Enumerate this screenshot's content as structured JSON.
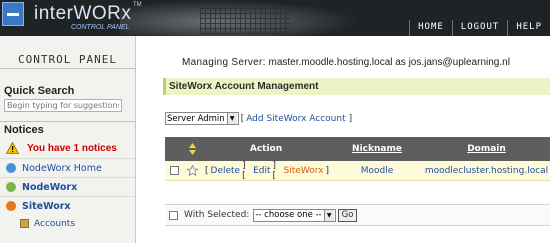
{
  "header": {
    "logo_text": "interWORx",
    "logo_tm": "TM",
    "logo_subtitle": "CONTROL PANEL",
    "nav": [
      "HOME",
      "LOGOUT",
      "HELP"
    ]
  },
  "sidebar": {
    "title": "CONTROL PANEL",
    "quick_search_heading": "Quick Search",
    "search_placeholder": "Begin typing for suggestions",
    "notices_heading": "Notices",
    "notice_text": "You have 1 notices",
    "items": [
      {
        "label": "NodeWorx Home",
        "icon": "nodeworx-home-icon",
        "color": "#4a8fd6"
      },
      {
        "label": "NodeWorx",
        "icon": "nodeworx-icon",
        "color": "#7ab648"
      },
      {
        "label": "SiteWorx",
        "icon": "siteworx-icon",
        "color": "#e07a1c"
      }
    ],
    "sub_items": [
      {
        "label": "Accounts",
        "icon": "accounts-icon"
      }
    ]
  },
  "main": {
    "managing_label": "Managing Server:",
    "managing_value": "master.moodle.hosting.local as jos.jans@uplearning.nl",
    "section_title": "SiteWorx Account Management",
    "toolbar": {
      "filter_value": "Server Admin",
      "add_link": "Add SiteWorx Account"
    },
    "table": {
      "headers": {
        "action": "Action",
        "nickname": "Nickname",
        "domain": "Domain"
      },
      "rows": [
        {
          "actions": [
            "Delete",
            "Edit",
            "SiteWorx"
          ],
          "nickname": "Moodle",
          "domain": "moodlecluster.hosting.local"
        }
      ]
    },
    "bulk": {
      "label": "With Selected:",
      "select_value": "-- choose one --",
      "go_label": "Go"
    }
  },
  "colors": {
    "header_bg": "#1f2326",
    "accent_link": "#1f4f9a",
    "notice_red": "#cc0000",
    "siteworx_orange": "#e05a0c",
    "row_highlight": "#fdfbd9",
    "section_bar": "#eef3c6"
  }
}
